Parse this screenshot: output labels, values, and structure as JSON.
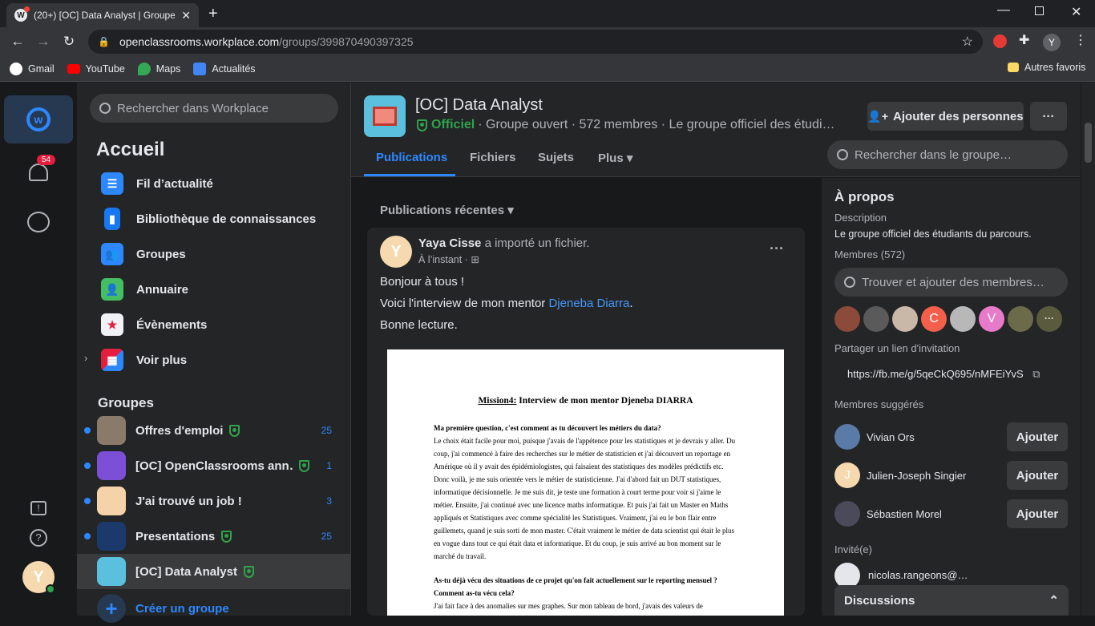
{
  "browser": {
    "tab_title": "(20+) [OC] Data Analyst | Groupe…",
    "url_domain": "openclassrooms.workplace.com",
    "url_path": "/groups/399870490397325",
    "profile_initial": "Y",
    "bookmarks": [
      "Gmail",
      "YouTube",
      "Maps",
      "Actualités"
    ],
    "other_bookmarks": "Autres favoris"
  },
  "rail": {
    "notification_count": "54",
    "avatar_initial": "Y"
  },
  "sidebar": {
    "search_placeholder": "Rechercher dans Workplace",
    "title": "Accueil",
    "nav": [
      "Fil d’actualité",
      "Bibliothèque de connaissances",
      "Groupes",
      "Annuaire",
      "Évènements",
      "Voir plus"
    ],
    "groups_heading": "Groupes",
    "groups": [
      {
        "name": "Offres d'emploi",
        "count": "25"
      },
      {
        "name": "[OC] OpenClassrooms ann…",
        "count": "1"
      },
      {
        "name": "J'ai trouvé un job !",
        "count": "3"
      },
      {
        "name": "Presentations",
        "count": "25"
      },
      {
        "name": "[OC] Data Analyst",
        "count": ""
      }
    ],
    "create_group": "Créer un groupe"
  },
  "group": {
    "name": "[OC] Data Analyst",
    "official": "Officiel",
    "meta": "· Groupe ouvert · 572 membres · Le groupe officiel des étudi…",
    "add_people": "Ajouter des personnes",
    "more": "···",
    "tabs": [
      "Publications",
      "Fichiers",
      "Sujets",
      "Plus"
    ],
    "search_placeholder": "Rechercher dans le groupe…"
  },
  "feed": {
    "sort_label": "Publications récentes",
    "post": {
      "author": "Yaya Cisse",
      "action": "a importé un fichier.",
      "time": "À l’instant ·",
      "avatar_initial": "Y",
      "line1": "Bonjour à tous !",
      "line2_prefix": "Voici l'interview de mon mentor ",
      "mention": "Djeneba Diarra",
      "line2_suffix": ".",
      "line3": "Bonne lecture.",
      "doc": {
        "title_prefix": "Mission4:",
        "title_rest": " Interview de mon mentor Djeneba DIARRA",
        "q1": "Ma première question, c'est comment as tu découvert les métiers du data?",
        "p1": "Le choix était facile pour moi, puisque j'avais de l'appétence pour les statistiques et je devrais y aller. Du coup, j'ai commencé à faire des recherches sur le métier de statisticien et j'ai découvert un reportage en Amérique où il y avait des épidémiologistes, qui faisaient des statistiques des modèles prédictifs etc. Donc voilà, je me suis orientée vers le métier de statisticienne. J'ai d'abord fait un DUT statistiques, informatique décisionnelle. Je me suis dit, je teste une formation à court terme pour voir si j'aime le métier. Ensuite, j'ai continué avec une licence maths informatique. Et puis j'ai fait un Master en Maths appliqués et Statistiques avec comme spécialité les Statistiques. Vraiment, j'ai eu le bon flair entre guillemets, quand je suis sorti de mon master. C'était vraiment le métier de data scientist qui était le plus en vogue dans tout ce qui était data et informatique. Et du coup, je suis arrivé au bon moment sur le marché du travail.",
        "q2": "As-tu déjà vécu des situations de ce projet qu'on fait actuellement sur le reporting mensuel ? Comment as-tu vécu cela?",
        "p2": "J'ai fait face à des anomalies sur mes graphes. Sur mon tableau de bord, j'avais des valeurs de"
      }
    }
  },
  "about": {
    "title": "À propos",
    "description_label": "Description",
    "description": "Le groupe officiel des étudiants du parcours.",
    "members_label": "Membres (572)",
    "find_members_placeholder": "Trouver et ajouter des membres…",
    "member_initials": [
      "C",
      "V"
    ],
    "more_members": "···",
    "invite_label": "Partager un lien d'invitation",
    "invite_link": "https://fb.me/g/5qeCkQ695/nMFEiYvS",
    "suggested_label": "Membres suggérés",
    "suggested": [
      {
        "name": "Vivian Ors",
        "button": "Ajouter"
      },
      {
        "name": "Julien-Joseph Singier",
        "button": "Ajouter",
        "initial": "J"
      },
      {
        "name": "Sébastien Morel",
        "button": "Ajouter"
      }
    ],
    "invited_label": "Invité(e)",
    "invited": "nicolas.rangeons@…"
  },
  "chat": {
    "label": "Discussions"
  }
}
